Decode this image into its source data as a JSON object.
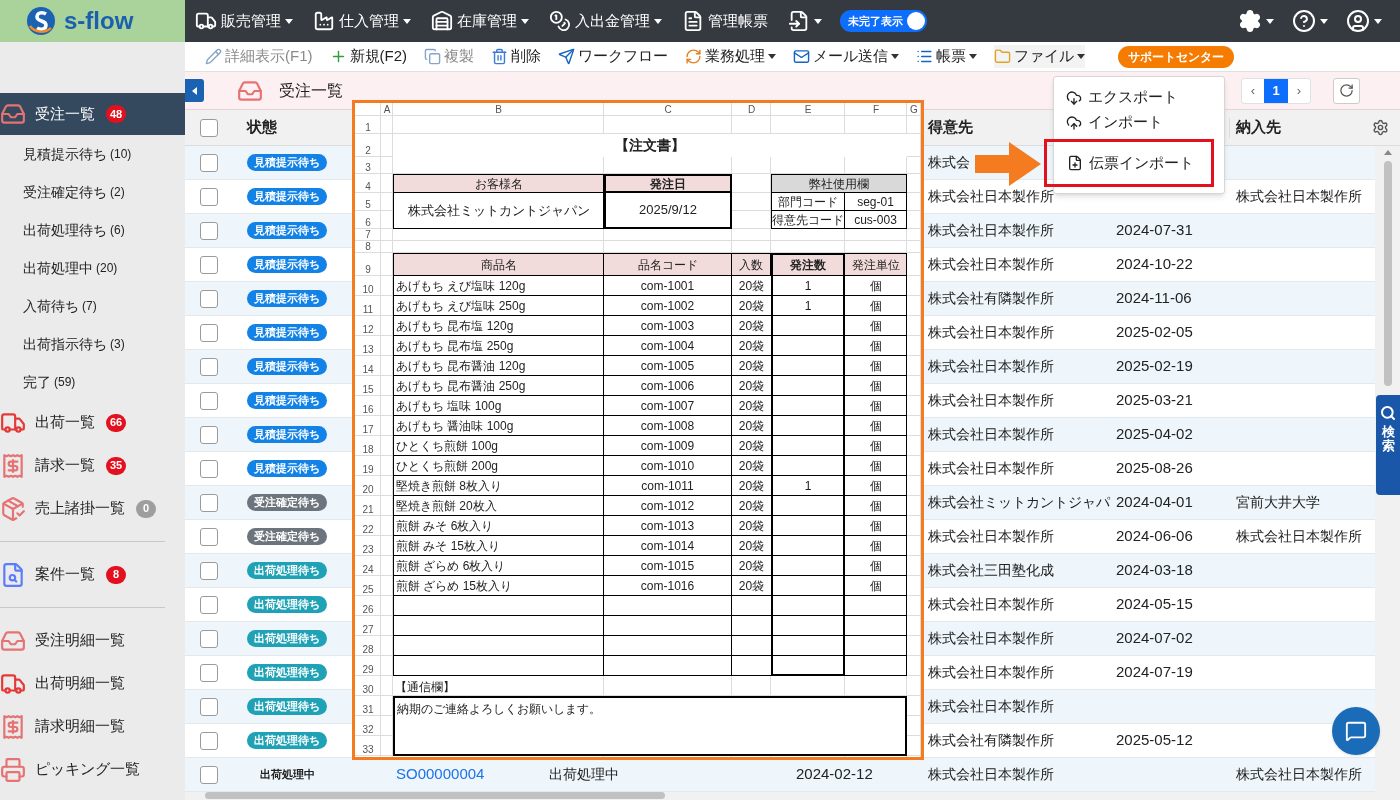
{
  "logo": {
    "text": "s-flow"
  },
  "top_menu": {
    "items": [
      {
        "label": "販売管理",
        "dropdown": true
      },
      {
        "label": "仕入管理",
        "dropdown": true
      },
      {
        "label": "在庫管理",
        "dropdown": true
      },
      {
        "label": "入出金管理",
        "dropdown": true
      },
      {
        "label": "管理帳票",
        "dropdown": false
      },
      {
        "dropdown": true
      }
    ],
    "toggle": {
      "label": "未完了表示",
      "on": true
    }
  },
  "toolbar": {
    "items": [
      {
        "label": "詳細表示(F1)",
        "disabled": true,
        "dropdown": false,
        "expanded": false
      },
      {
        "label": "新規(F2)",
        "disabled": false,
        "dropdown": false,
        "expanded": false
      },
      {
        "label": "複製",
        "disabled": true,
        "dropdown": false,
        "expanded": false
      },
      {
        "label": "削除",
        "disabled": false,
        "dropdown": false,
        "expanded": false
      },
      {
        "label": "ワークフロー",
        "disabled": false,
        "dropdown": false,
        "expanded": false
      },
      {
        "label": "業務処理",
        "disabled": false,
        "dropdown": true,
        "expanded": false
      },
      {
        "label": "メール送信",
        "disabled": false,
        "dropdown": true,
        "expanded": false
      },
      {
        "label": "帳票",
        "disabled": false,
        "dropdown": true,
        "expanded": false
      },
      {
        "label": "ファイル",
        "disabled": false,
        "dropdown": true,
        "expanded": true
      }
    ],
    "support": "サポートセンター"
  },
  "file_menu": {
    "items": [
      {
        "label": "エクスポート",
        "highlighted": false
      },
      {
        "label": "インポート",
        "highlighted": false
      },
      {
        "label": "伝票インポート",
        "highlighted": true
      }
    ]
  },
  "sidebar": {
    "items": [
      {
        "kind": "link",
        "label": "受注一覧",
        "badge": "48",
        "color": "#e3101e",
        "selected": true,
        "children": [
          {
            "label": "見積提示待ち",
            "count": "(10)",
            "selected": false
          },
          {
            "label": "受注確定待ち",
            "count": "(2)",
            "selected": false
          },
          {
            "label": "出荷処理待ち",
            "count": "(6)",
            "selected": false
          },
          {
            "label": "出荷処理中",
            "count": "(20)",
            "selected": false
          },
          {
            "label": "入荷待ち",
            "count": "(7)",
            "selected": false
          },
          {
            "label": "出荷指示待ち",
            "count": "(3)",
            "selected": false
          },
          {
            "label": "完了",
            "count": "(59)",
            "selected": false
          }
        ]
      },
      {
        "kind": "link",
        "label": "出荷一覧",
        "badge": "66",
        "color": "#e3101e",
        "selected": false
      },
      {
        "kind": "link",
        "label": "請求一覧",
        "badge": "35",
        "color": "#e3101e",
        "selected": false
      },
      {
        "kind": "link",
        "label": "売上諸掛一覧",
        "badge": "0",
        "color": "#9e9e9e",
        "selected": false
      },
      {
        "kind": "divider"
      },
      {
        "kind": "link",
        "label": "案件一覧",
        "badge": "8",
        "color": "#e3101e",
        "selected": false
      },
      {
        "kind": "divider"
      },
      {
        "kind": "link",
        "label": "受注明細一覧",
        "selected": false
      },
      {
        "kind": "link",
        "label": "出荷明細一覧",
        "selected": false
      },
      {
        "kind": "link",
        "label": "請求明細一覧",
        "selected": false
      },
      {
        "kind": "link",
        "label": "ピッキング一覧",
        "selected": false
      }
    ]
  },
  "page_header": {
    "title": "受注一覧"
  },
  "pagination": {
    "prev": "‹",
    "pages": [
      {
        "label": "1",
        "selected": true
      }
    ],
    "next": "›"
  },
  "table": {
    "select_all": {
      "checked": false
    },
    "headers": {
      "status": "状態",
      "customer": "得意先",
      "delivery": "納入先"
    },
    "rows": [
      {
        "checked": false,
        "status": {
          "kind": "quote",
          "label": "見積提示待ち"
        },
        "customer": "株式会"
      },
      {
        "checked": false,
        "status": {
          "kind": "quote",
          "label": "見積提示待ち"
        },
        "customer": "株式会社日本製作所",
        "delivery": "株式会社日本製作所"
      },
      {
        "checked": false,
        "status": {
          "kind": "quote",
          "label": "見積提示待ち"
        },
        "customer": "株式会社日本製作所",
        "date": "2024-07-31"
      },
      {
        "checked": false,
        "status": {
          "kind": "quote",
          "label": "見積提示待ち"
        },
        "customer": "株式会社日本製作所",
        "date": "2024-10-22"
      },
      {
        "checked": false,
        "status": {
          "kind": "quote",
          "label": "見積提示待ち"
        },
        "customer": "株式会社有隣製作所",
        "date": "2024-11-06"
      },
      {
        "checked": false,
        "status": {
          "kind": "quote",
          "label": "見積提示待ち"
        },
        "customer": "株式会社日本製作所",
        "date": "2025-02-05"
      },
      {
        "checked": false,
        "status": {
          "kind": "quote",
          "label": "見積提示待ち"
        },
        "customer": "株式会社日本製作所",
        "date": "2025-02-19"
      },
      {
        "checked": false,
        "status": {
          "kind": "quote",
          "label": "見積提示待ち"
        },
        "customer": "株式会社日本製作所",
        "date": "2025-03-21"
      },
      {
        "checked": false,
        "status": {
          "kind": "quote",
          "label": "見積提示待ち"
        },
        "customer": "株式会社日本製作所",
        "date": "2025-04-02"
      },
      {
        "checked": false,
        "status": {
          "kind": "quote",
          "label": "見積提示待ち"
        },
        "customer": "株式会社日本製作所",
        "date": "2025-08-26"
      },
      {
        "checked": false,
        "status": {
          "kind": "confirm",
          "label": "受注確定待ち"
        },
        "customer": "株式会社ミットカントジャパ",
        "date": "2024-04-01",
        "delivery": "宮前大井大学"
      },
      {
        "checked": false,
        "status": {
          "kind": "confirm",
          "label": "受注確定待ち"
        },
        "customer": "株式会社日本製作所",
        "date": "2024-06-06",
        "delivery": "株式会社日本製作所"
      },
      {
        "checked": false,
        "status": {
          "kind": "ship_wait",
          "label": "出荷処理待ち"
        },
        "customer": "株式会社三田塾化成",
        "date": "2024-03-18"
      },
      {
        "checked": false,
        "status": {
          "kind": "ship_wait",
          "label": "出荷処理待ち"
        },
        "customer": "株式会社日本製作所",
        "date": "2024-05-15"
      },
      {
        "checked": false,
        "status": {
          "kind": "ship_wait",
          "label": "出荷処理待ち"
        },
        "customer": "株式会社日本製作所",
        "date": "2024-07-02"
      },
      {
        "checked": false,
        "status": {
          "kind": "ship_wait",
          "label": "出荷処理待ち"
        },
        "customer": "株式会社日本製作所",
        "date": "2024-07-19"
      },
      {
        "checked": false,
        "status": {
          "kind": "ship_wait",
          "label": "出荷処理待ち"
        },
        "customer": "株式会社日本製作所"
      },
      {
        "checked": false,
        "status": {
          "kind": "ship_wait",
          "label": "出荷処理待ち"
        },
        "customer": "株式会社有隣製作所",
        "date": "2025-05-12"
      },
      {
        "checked": false,
        "status": {
          "kind": "shipping",
          "label": "出荷処理中"
        },
        "order_no": "SO00000004",
        "status_text": "出荷処理中",
        "order_date": "2024-02-12",
        "customer": "株式会社日本製作所",
        "delivery": "株式会社日本製作所"
      }
    ]
  },
  "order_sheet": {
    "columns": [
      "A",
      "B",
      "C",
      "D",
      "E",
      "F",
      "G"
    ],
    "row_numbers": [
      "1",
      "2",
      "3",
      "4",
      "5",
      "6",
      "7",
      "8",
      "9",
      "10",
      "11",
      "12",
      "13",
      "14",
      "15",
      "16",
      "17",
      "18",
      "19",
      "20",
      "21",
      "22",
      "23",
      "24",
      "25",
      "26",
      "27",
      "28",
      "29",
      "30",
      "31",
      "32",
      "33"
    ],
    "title": "【注文書】",
    "customer_label": "お客様名",
    "customer": "株式会社ミットカントジャパン",
    "date_label": "発注日",
    "date": "2025/9/12",
    "internal_label": "弊社使用欄",
    "internal_fields": [
      {
        "label": "部門コード",
        "value": "seg-01"
      },
      {
        "label": "得意先コード",
        "value": "cus-003"
      }
    ],
    "item_headers": [
      "商品名",
      "品名コード",
      "入数",
      "発注数",
      "発注単位"
    ],
    "items": [
      {
        "name": "あげもち えび塩味 120g",
        "code": "com-1001",
        "pack": "20袋",
        "qty": "1",
        "unit": "個"
      },
      {
        "name": "あげもち えび塩味 250g",
        "code": "com-1002",
        "pack": "20袋",
        "qty": "1",
        "unit": "個"
      },
      {
        "name": "あげもち 昆布塩 120g",
        "code": "com-1003",
        "pack": "20袋",
        "unit": "個"
      },
      {
        "name": "あげもち 昆布塩 250g",
        "code": "com-1004",
        "pack": "20袋",
        "unit": "個"
      },
      {
        "name": "あげもち 昆布醤油 120g",
        "code": "com-1005",
        "pack": "20袋",
        "unit": "個"
      },
      {
        "name": "あげもち 昆布醤油 250g",
        "code": "com-1006",
        "pack": "20袋",
        "unit": "個"
      },
      {
        "name": "あげもち 塩味 100g",
        "code": "com-1007",
        "pack": "20袋",
        "unit": "個"
      },
      {
        "name": "あげもち 醤油味 100g",
        "code": "com-1008",
        "pack": "20袋",
        "unit": "個"
      },
      {
        "name": "ひとくち煎餅 100g",
        "code": "com-1009",
        "pack": "20袋",
        "unit": "個"
      },
      {
        "name": "ひとくち煎餅 200g",
        "code": "com-1010",
        "pack": "20袋",
        "unit": "個"
      },
      {
        "name": "堅焼き煎餅 8枚入り",
        "code": "com-1011",
        "pack": "20袋",
        "qty": "1",
        "unit": "個"
      },
      {
        "name": "堅焼き煎餅 20枚入",
        "code": "com-1012",
        "pack": "20袋",
        "unit": "個"
      },
      {
        "name": "煎餅 みそ 6枚入り",
        "code": "com-1013",
        "pack": "20袋",
        "unit": "個"
      },
      {
        "name": "煎餅 みそ 15枚入り",
        "code": "com-1014",
        "pack": "20袋",
        "unit": "個"
      },
      {
        "name": "煎餅 ざらめ 6枚入り",
        "code": "com-1015",
        "pack": "20袋",
        "unit": "個"
      },
      {
        "name": "煎餅 ざらめ 15枚入り",
        "code": "com-1016",
        "pack": "20袋",
        "unit": "個"
      }
    ],
    "note_label": "【通信欄】",
    "note": "納期のご連絡よろしくお願いします。"
  },
  "search_tab": {
    "label": "検索"
  }
}
